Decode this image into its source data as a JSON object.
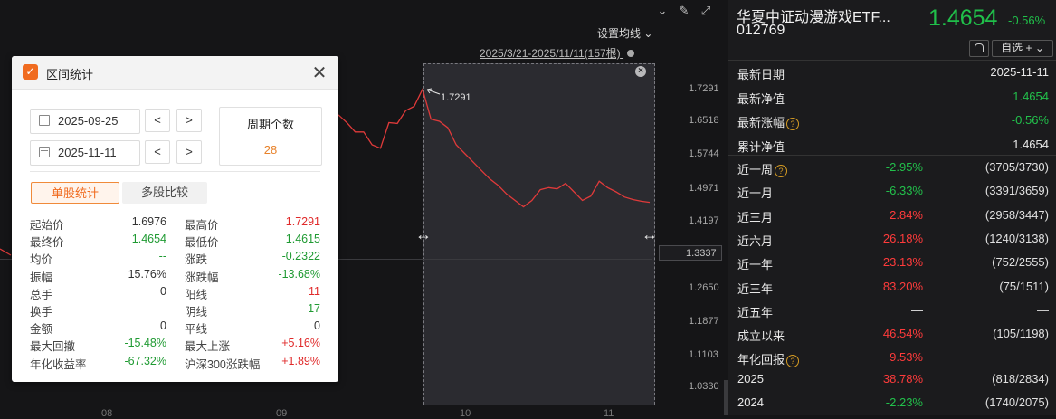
{
  "chart": {
    "settings_label": "设置均线",
    "settings_chevron": "⌄",
    "range_label": "2025/3/21-2025/11/11(157根)",
    "pin_icon": "📌",
    "y_ticks": [
      "1.7291",
      "1.6518",
      "1.5744",
      "1.4971",
      "1.4197",
      "1.2650",
      "1.1877",
      "1.1103",
      "1.0330"
    ],
    "current_price": "1.3337",
    "peak_label": "1.7291",
    "x_ticks": [
      "08",
      "09",
      "10",
      "11"
    ],
    "close_glyph": "×",
    "resize_left": "↔",
    "resize_right": "↔",
    "line_color": "#e03a3a",
    "line_values": [
      1.67,
      1.6518,
      1.63,
      1.63,
      1.6,
      1.592,
      1.6518,
      1.65,
      1.68,
      1.69,
      1.73,
      1.66,
      1.655,
      1.64,
      1.6,
      1.58,
      1.56,
      1.54,
      1.52,
      1.505,
      1.485,
      1.47,
      1.455,
      1.47,
      1.495,
      1.5,
      1.497,
      1.51,
      1.49,
      1.47,
      1.48,
      1.515,
      1.5,
      1.49,
      1.478,
      1.472,
      1.468,
      1.4654
    ]
  },
  "topbar": {
    "icons": [
      "chevron-circle-icon",
      "brush-icon",
      "expand-icon",
      "close-icon"
    ],
    "glyphs": [
      "⌄",
      "✎",
      "⤢",
      "✕"
    ]
  },
  "dialog": {
    "title": "区间统计",
    "logo_glyph": "✓",
    "close_glyph": "✕",
    "start_date": "2025-09-25",
    "end_date": "2025-11-11",
    "prev": "<",
    "next": ">",
    "period_label": "周期个数",
    "period_value": "28",
    "tab_single": "单股统计",
    "tab_multi": "多股比较",
    "stats_left": [
      {
        "label": "起始价",
        "value": "1.6976",
        "color": "black"
      },
      {
        "label": "最终价",
        "value": "1.4654",
        "color": "green"
      },
      {
        "label": "均价",
        "value": "--",
        "color": "green"
      },
      {
        "label": "振幅",
        "value": "15.76%",
        "color": "black"
      },
      {
        "label": "总手",
        "value": "0",
        "color": "black"
      },
      {
        "label": "换手",
        "value": "--",
        "color": "black"
      },
      {
        "label": "金额",
        "value": "0",
        "color": "black"
      },
      {
        "label": "最大回撤",
        "value": "-15.48%",
        "color": "green"
      },
      {
        "label": "年化收益率",
        "value": "-67.32%",
        "color": "green"
      }
    ],
    "stats_right": [
      {
        "label": "最高价",
        "value": "1.7291",
        "color": "red"
      },
      {
        "label": "最低价",
        "value": "1.4615",
        "color": "green"
      },
      {
        "label": "涨跌",
        "value": "-0.2322",
        "color": "green"
      },
      {
        "label": "涨跌幅",
        "value": "-13.68%",
        "color": "green"
      },
      {
        "label": "阳线",
        "value": "11",
        "color": "red"
      },
      {
        "label": "阴线",
        "value": "17",
        "color": "green"
      },
      {
        "label": "平线",
        "value": "0",
        "color": "black"
      },
      {
        "label": "最大上涨",
        "value": "+5.16%",
        "color": "red"
      },
      {
        "label": "沪深300涨跌幅",
        "value": "+1.89%",
        "color": "red"
      }
    ]
  },
  "panel": {
    "name": "华夏中证动漫游戏ETF...",
    "code": "012769",
    "price": "1.4654",
    "change": "-0.56%",
    "bell_glyph": "🔔",
    "fav_label": "自选 +",
    "fav_chevron": "⌄",
    "info": [
      {
        "label": "最新日期",
        "value": "2025-11-11",
        "color": "white",
        "help": false
      },
      {
        "label": "最新净值",
        "value": "1.4654",
        "color": "green",
        "help": false
      },
      {
        "label": "最新涨幅",
        "value": "-0.56%",
        "color": "green",
        "help": true
      },
      {
        "label": "累计净值",
        "value": "1.4654",
        "color": "white",
        "help": false
      }
    ],
    "help_glyph": "?",
    "perf": [
      {
        "label": "近一周",
        "pct": "-2.95%",
        "rank": "(3705/3730)",
        "color": "green",
        "help": true
      },
      {
        "label": "近一月",
        "pct": "-6.33%",
        "rank": "(3391/3659)",
        "color": "green",
        "help": false
      },
      {
        "label": "近三月",
        "pct": "2.84%",
        "rank": "(2958/3447)",
        "color": "red",
        "help": false
      },
      {
        "label": "近六月",
        "pct": "26.18%",
        "rank": "(1240/3138)",
        "color": "red",
        "help": false
      },
      {
        "label": "近一年",
        "pct": "23.13%",
        "rank": "(752/2555)",
        "color": "red",
        "help": false
      },
      {
        "label": "近三年",
        "pct": "83.20%",
        "rank": "(75/1511)",
        "color": "red",
        "help": false
      },
      {
        "label": "近五年",
        "pct": "—",
        "rank": "—",
        "color": "white",
        "help": false
      },
      {
        "label": "成立以来",
        "pct": "46.54%",
        "rank": "(105/1198)",
        "color": "red",
        "help": false
      },
      {
        "label": "年化回报",
        "pct": "9.53%",
        "rank": "",
        "color": "red",
        "help": true
      }
    ],
    "years": [
      {
        "label": "2025",
        "pct": "38.78%",
        "rank": "(818/2834)",
        "color": "red"
      },
      {
        "label": "2024",
        "pct": "-2.23%",
        "rank": "(1740/2075)",
        "color": "green"
      }
    ]
  }
}
